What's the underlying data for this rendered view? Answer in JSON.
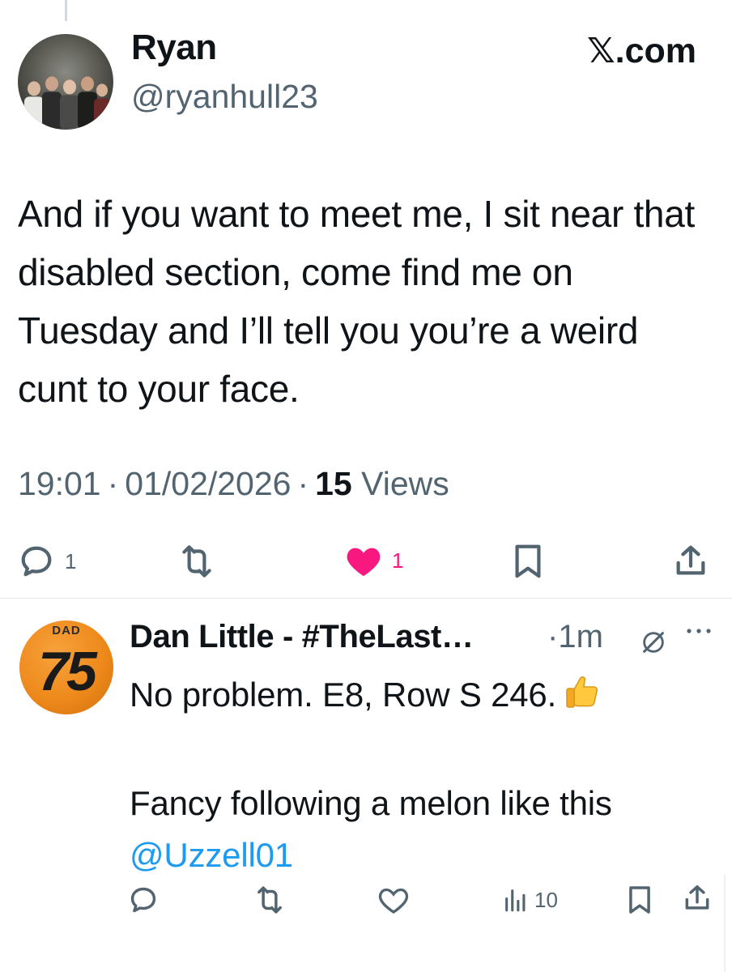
{
  "tweet": {
    "author_name": "Ryan",
    "author_handle": "@ryanhull23",
    "source": "𝕏.com",
    "text": "And if you want to meet me, I sit near that disabled section, come find me on Tuesday and I’ll tell you you’re a weird cunt to your face.",
    "time": "19:01",
    "date": "01/02/2026",
    "views_count": "15",
    "views_label": "Views",
    "replies": "1",
    "likes": "1",
    "colors": {
      "like": "#f91880",
      "text_secondary": "#536471",
      "link": "#1d9bf0"
    }
  },
  "reply": {
    "author_name": "Dan Little - #TheLast…",
    "time": "1m",
    "avatar_label": "DAD",
    "avatar_number": "75",
    "line1": "No problem. E8, Row S 246.",
    "line2": "Fancy following a melon like this",
    "mention": "@Uzzell01",
    "views": "10"
  }
}
